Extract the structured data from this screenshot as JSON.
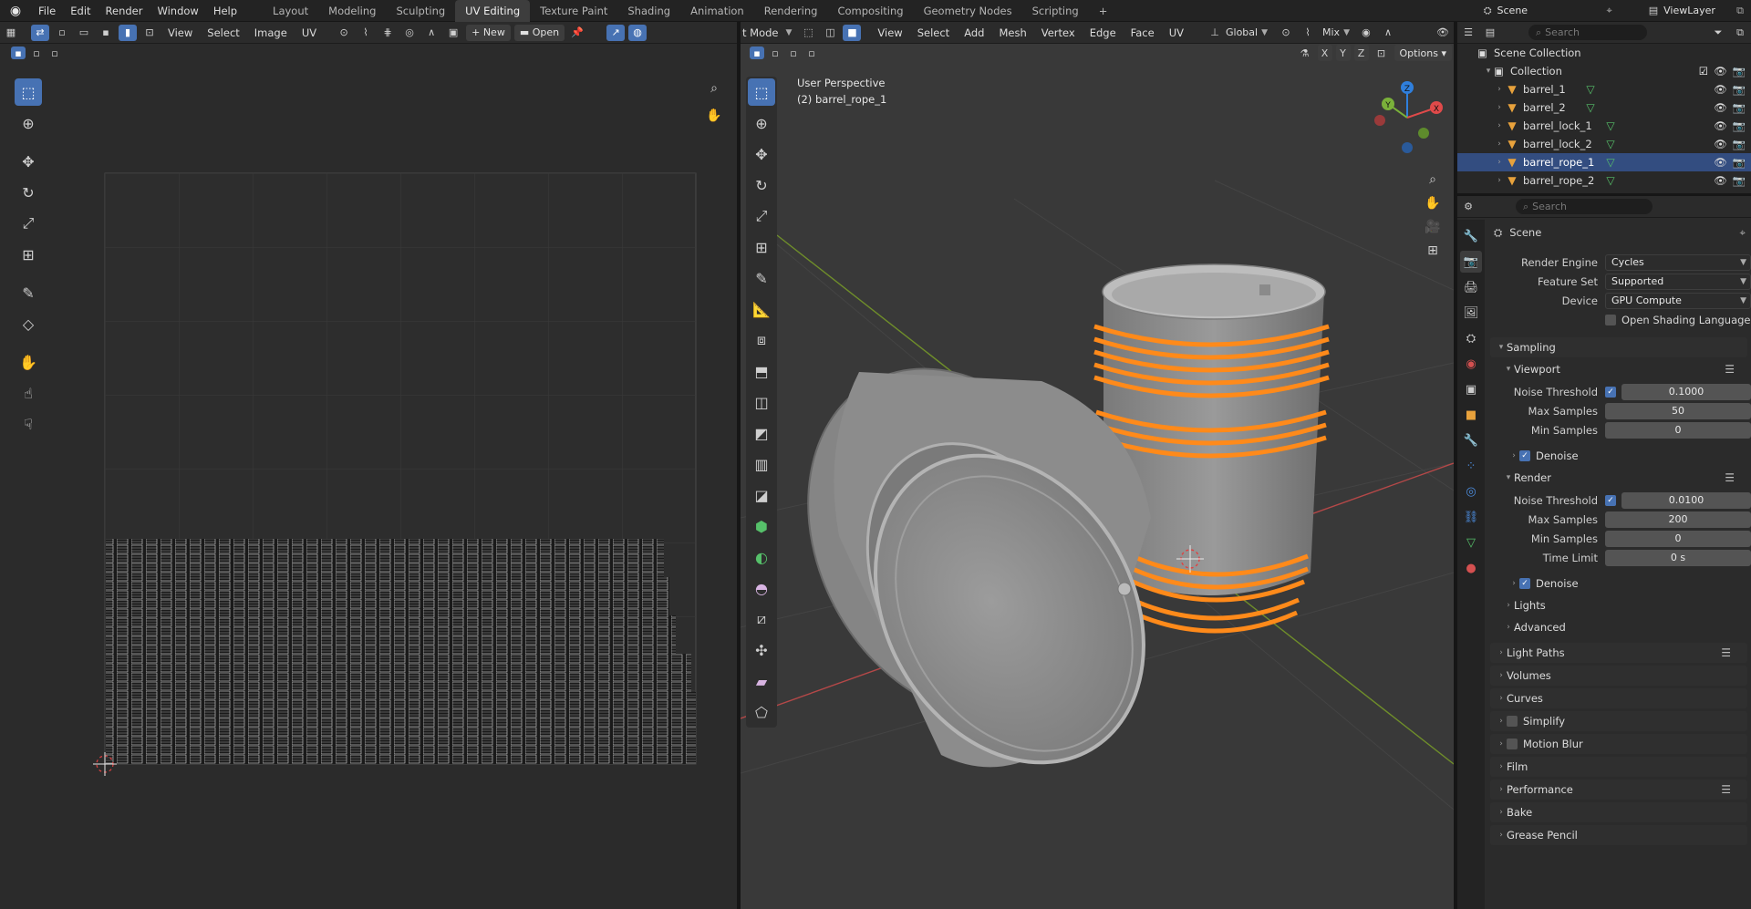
{
  "menus": {
    "file": "File",
    "edit": "Edit",
    "render": "Render",
    "window": "Window",
    "help": "Help"
  },
  "workspaces": [
    "Layout",
    "Modeling",
    "Sculpting",
    "UV Editing",
    "Texture Paint",
    "Shading",
    "Animation",
    "Rendering",
    "Compositing",
    "Geometry Nodes",
    "Scripting"
  ],
  "workspace_add": "+",
  "scene_name": "Scene",
  "view_layer": "ViewLayer",
  "uv_editor": {
    "menus": {
      "view": "View",
      "select": "Select",
      "image": "Image",
      "uv": "UV"
    },
    "new_label": "New",
    "open_label": "Open"
  },
  "viewport": {
    "mode_label": "t Mode",
    "menus": {
      "view": "View",
      "select": "Select",
      "add": "Add",
      "mesh": "Mesh",
      "vertex": "Vertex",
      "edge": "Edge",
      "face": "Face",
      "uv": "UV"
    },
    "orientation": "Global",
    "snap_mode": "Mix",
    "axes": {
      "x": "X",
      "y": "Y",
      "z": "Z"
    },
    "options_label": "Options",
    "perspective_text": "User Perspective",
    "active_object_text": "(2) barrel_rope_1",
    "gizmo": {
      "x": "X",
      "y": "Y",
      "z": "Z"
    }
  },
  "outliner": {
    "search_placeholder": "Search",
    "scene_collection": "Scene Collection",
    "collection": "Collection",
    "items": [
      {
        "name": "barrel_1",
        "selected": false
      },
      {
        "name": "barrel_2",
        "selected": false
      },
      {
        "name": "barrel_lock_1",
        "selected": false
      },
      {
        "name": "barrel_lock_2",
        "selected": false
      },
      {
        "name": "barrel_rope_1",
        "selected": true
      },
      {
        "name": "barrel_rope_2",
        "selected": false
      }
    ]
  },
  "properties": {
    "search_placeholder": "Search",
    "context_title": "Scene",
    "render_engine": {
      "label": "Render Engine",
      "value": "Cycles"
    },
    "feature_set": {
      "label": "Feature Set",
      "value": "Supported"
    },
    "device": {
      "label": "Device",
      "value": "GPU Compute"
    },
    "open_shading_language": "Open Shading Language",
    "sampling": "Sampling",
    "viewport_section": "Viewport",
    "viewport_noise_threshold": {
      "label": "Noise Threshold",
      "value": "0.1000"
    },
    "viewport_max_samples": {
      "label": "Max Samples",
      "value": "50"
    },
    "viewport_min_samples": {
      "label": "Min Samples",
      "value": "0"
    },
    "denoise_label": "Denoise",
    "render_section": "Render",
    "render_noise_threshold": {
      "label": "Noise Threshold",
      "value": "0.0100"
    },
    "render_max_samples": {
      "label": "Max Samples",
      "value": "200"
    },
    "render_min_samples": {
      "label": "Min Samples",
      "value": "0"
    },
    "render_time_limit": {
      "label": "Time Limit",
      "value": "0 s"
    },
    "lights": "Lights",
    "advanced": "Advanced",
    "panels": {
      "light_paths": "Light Paths",
      "volumes": "Volumes",
      "curves": "Curves",
      "simplify": "Simplify",
      "motion_blur": "Motion Blur",
      "film": "Film",
      "performance": "Performance",
      "bake": "Bake",
      "grease_pencil": "Grease Pencil"
    }
  },
  "colors": {
    "accent": "#4772b3",
    "selection_orange": "#ff8a1a",
    "mesh_icon": "#e8a23c",
    "data_icon": "#56c06a"
  }
}
